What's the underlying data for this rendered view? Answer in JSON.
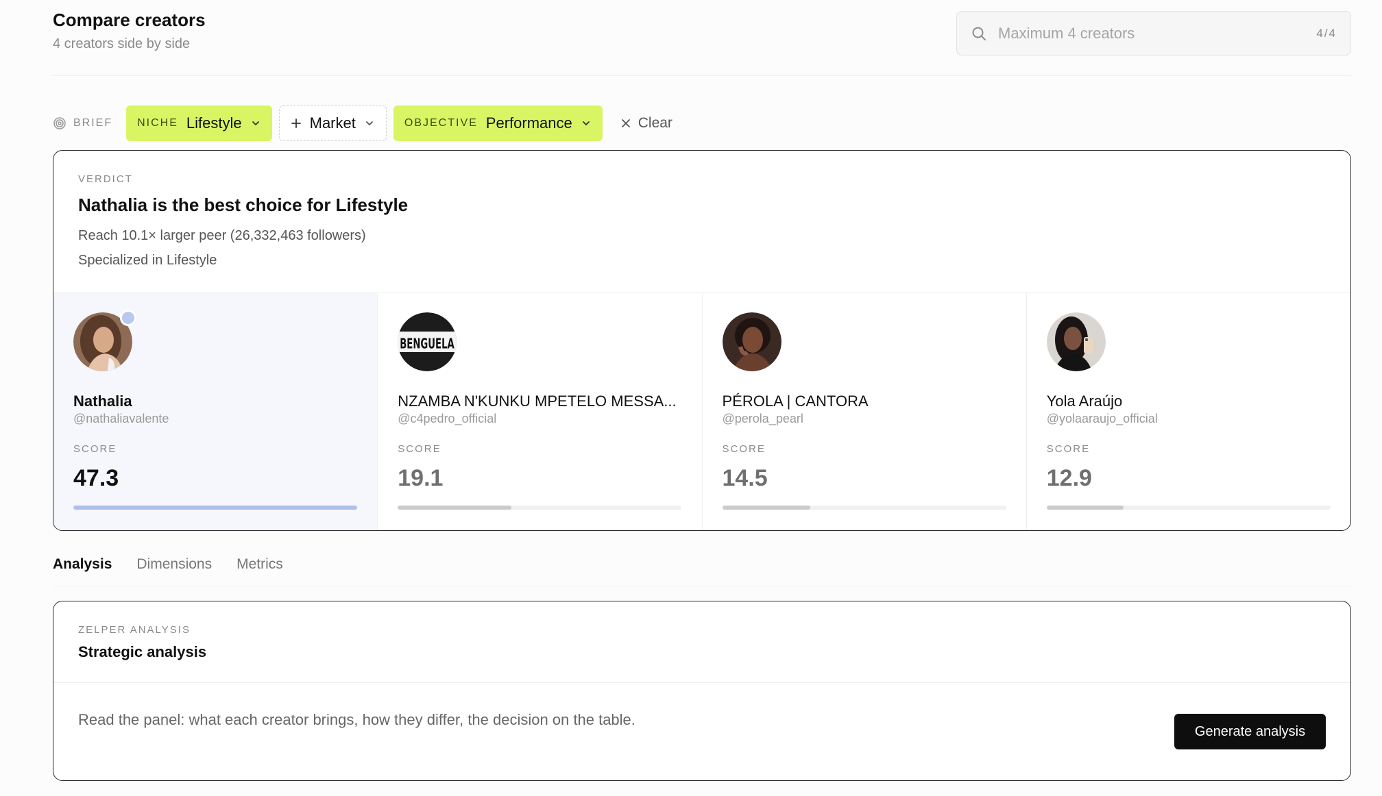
{
  "header": {
    "title": "Compare creators",
    "subtitle": "4 creators side by side"
  },
  "search": {
    "placeholder": "Maximum 4 creators",
    "count": "4/4"
  },
  "brief": {
    "label": "BRIEF",
    "filters": [
      {
        "key": "NICHE",
        "value": "Lifestyle"
      },
      {
        "key": "",
        "value": "Market"
      },
      {
        "key": "OBJECTIVE",
        "value": "Performance"
      }
    ],
    "clear_label": "Clear"
  },
  "verdict": {
    "eyebrow": "VERDICT",
    "headline": "Nathalia is the best choice for Lifestyle",
    "reasons": [
      "Reach 10.1× larger peer (26,332,463 followers)",
      "Specialized in Lifestyle"
    ]
  },
  "creators": [
    {
      "name": "Nathalia",
      "handle": "@nathaliavalente",
      "score_label": "SCORE",
      "score": "47.3",
      "score_fraction": 1.0,
      "best": true,
      "avatar": "portrait-photo"
    },
    {
      "name": "NZAMBA N'KUNKU MPETELO MESSA...",
      "handle": "@c4pedro_official",
      "score_label": "SCORE",
      "score": "19.1",
      "score_fraction": 0.4,
      "best": false,
      "avatar": "benguela-logo",
      "avatar_text": "BENGUELA"
    },
    {
      "name": "PÉROLA | CANTORA",
      "handle": "@perola_pearl",
      "score_label": "SCORE",
      "score": "14.5",
      "score_fraction": 0.31,
      "best": false,
      "avatar": "portrait-photo"
    },
    {
      "name": "Yola Araújo",
      "handle": "@yolaaraujo_official",
      "score_label": "SCORE",
      "score": "12.9",
      "score_fraction": 0.27,
      "best": false,
      "avatar": "portrait-photo"
    }
  ],
  "tabs": [
    {
      "label": "Analysis",
      "active": true
    },
    {
      "label": "Dimensions",
      "active": false
    },
    {
      "label": "Metrics",
      "active": false
    }
  ],
  "analysis": {
    "eyebrow": "ZELPER ANALYSIS",
    "title": "Strategic analysis",
    "description": "Read the panel: what each creator brings, how they differ, the decision on the table.",
    "button_label": "Generate analysis"
  },
  "colors": {
    "accent_lime": "#d9f564",
    "best_fill": "#aebfe8",
    "best_bg": "#f5f7fc",
    "dark_button": "#0e0e0e"
  }
}
